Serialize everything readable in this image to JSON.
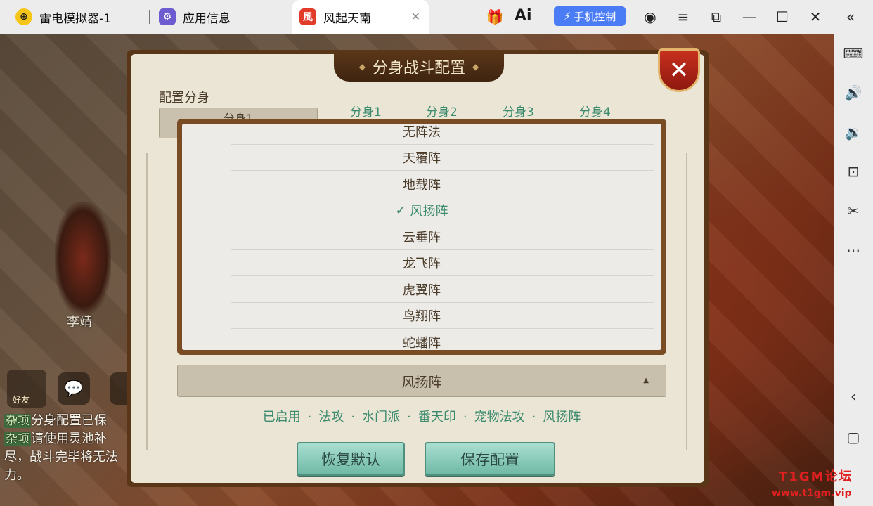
{
  "window": {
    "tabs": [
      {
        "label": "雷电模拟器-1",
        "icon": "ldplayer-logo-icon"
      },
      {
        "label": "应用信息",
        "icon": "gear-app-icon"
      },
      {
        "label": "风起天南",
        "icon": "game-app-icon",
        "active": true
      }
    ],
    "ai_label": "Ai",
    "phone_control": "手机控制",
    "close_tab": "✕"
  },
  "game": {
    "character_name": "李靖",
    "friend_label": "好友",
    "chat_log": [
      {
        "tag": "杂项",
        "text": "分身配置已保"
      },
      {
        "tag": "杂项",
        "text": "请使用灵池补"
      },
      {
        "tag": "",
        "text": "尽，战斗完毕将无法"
      },
      {
        "tag": "",
        "text": "力。"
      }
    ]
  },
  "dialog": {
    "title": "分身战斗配置",
    "config_label": "配置分身",
    "clone_selected": "分身1",
    "clone_tabs": [
      "分身1",
      "分身2",
      "分身3",
      "分身4"
    ],
    "formations": [
      "无阵法",
      "天覆阵",
      "地载阵",
      "风扬阵",
      "云垂阵",
      "龙飞阵",
      "虎翼阵",
      "鸟翔阵",
      "蛇蟠阵"
    ],
    "selected_formation_index": 3,
    "check_mark": "✓",
    "current_formation": "风扬阵",
    "summary": [
      "已启用",
      "法攻",
      "水门派",
      "番天印",
      "宠物法攻",
      "风扬阵"
    ],
    "reset_button": "恢复默认",
    "save_button": "保存配置"
  },
  "watermark": {
    "line1": "T1GM论坛",
    "line2": "www.t1gm.vip"
  },
  "colors": {
    "accent_green": "#3a8a6c",
    "dialog_frame": "#5a3618",
    "phone_control_blue": "#4a7cf5"
  }
}
